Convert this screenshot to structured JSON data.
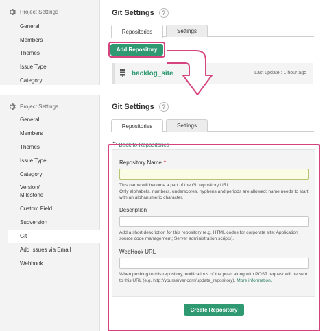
{
  "colors": {
    "accent_green": "#2f9a72",
    "highlight_pink": "#d6447f",
    "link_green": "#2a7a5f"
  },
  "icons": {
    "settings": "gear-icon",
    "help": "help-icon",
    "repo": "repository-icon",
    "back": "back-arrow-icon",
    "flow": "arrow-down-icon"
  },
  "sidebar": {
    "header": "Project Settings",
    "items_top": [
      "General",
      "Members",
      "Themes",
      "Issue Type",
      "Category"
    ],
    "items": [
      "General",
      "Members",
      "Themes",
      "Issue Type",
      "Category",
      "Version/",
      "Milestone",
      "Custom Field",
      "Subversion",
      "Git",
      "Add Issues via Email",
      "Webhook"
    ]
  },
  "main": {
    "title": "Git Settings",
    "help": "?",
    "tabs": {
      "repositories": "Repositories",
      "settings": "Settings"
    },
    "add_button": "Add Repository",
    "repo": {
      "name": "backlog_site",
      "last_update": "Last update : 1 hour ago"
    },
    "back_link": "Back to Repositories",
    "back_arrow": "⮌"
  },
  "form": {
    "repo_name_label": "Repository Name",
    "required_mark": "*",
    "repo_name_value": "",
    "repo_name_hint_1": "This name will become a part of the Git repository URL.",
    "repo_name_hint_2": "Only alphabets, numbers, underscores, hyphens and periods are allowed; name needs to start with an alphanumeric character.",
    "description_label": "Description",
    "description_value": "",
    "description_hint": "Add a short description for this repository (e.g. HTML codes for corporate site; Application source code management; Server administration scripts).",
    "webhook_label": "WebHook URL",
    "webhook_value": "",
    "webhook_hint": "When pushing to this repository, notifications of the push along with POST request will be sent to this URL (e.g. http://yourserver.com/update_repository).",
    "more_info": "More information.",
    "create_button": "Create Repository"
  }
}
